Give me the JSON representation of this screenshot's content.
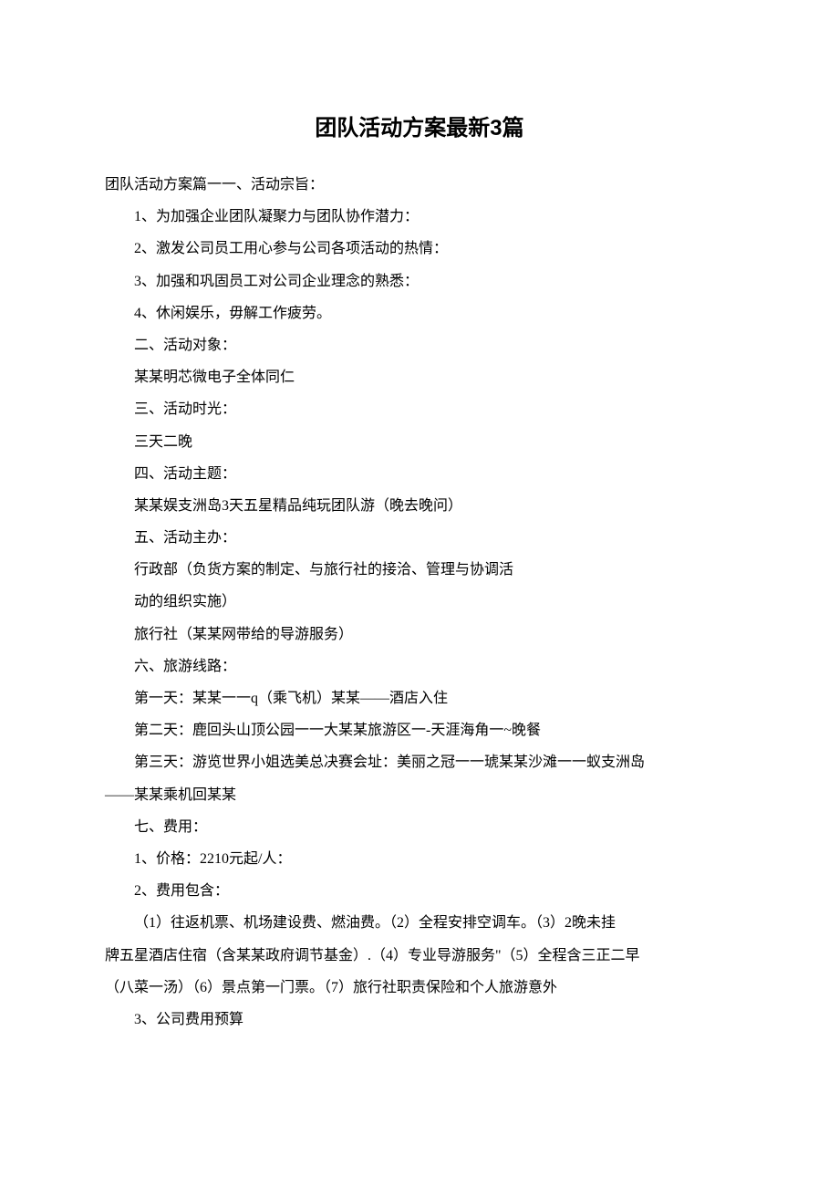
{
  "title": "团队活动方案最新3篇",
  "lines": [
    {
      "text": "团队活动方案篇一一、活动宗旨：",
      "indent": false
    },
    {
      "text": "1、为加强企业团队凝聚力与团队协作潜力：",
      "indent": true
    },
    {
      "text": "2、激发公司员工用心参与公司各项活动的热情：",
      "indent": true
    },
    {
      "text": "3、加强和巩固员工对公司企业理念的熟悉：",
      "indent": true
    },
    {
      "text": "4、休闲娱乐，毋解工作疲劳。",
      "indent": true
    },
    {
      "text": "二、活动对象：",
      "indent": true
    },
    {
      "text": "某某明芯微电子全体同仁",
      "indent": true
    },
    {
      "text": "三、活动时光：",
      "indent": true
    },
    {
      "text": "三天二晚",
      "indent": true
    },
    {
      "text": "四、活动主题：",
      "indent": true
    },
    {
      "text": "某某娱支洲岛3天五星精品纯玩团队游（晚去晚问）",
      "indent": true
    },
    {
      "text": "五、活动主办：",
      "indent": true
    },
    {
      "text": "行政部（负货方案的制定、与旅行社的接洽、管理与协调活",
      "indent": true
    },
    {
      "text": "动的组织实施）",
      "indent": true
    },
    {
      "text": "旅行社（某某网带给的导游服务）",
      "indent": true
    },
    {
      "text": "六、旅游线路：",
      "indent": true
    },
    {
      "text": "第一天：某某一一q（乘飞机）某某——酒店入住",
      "indent": true
    },
    {
      "text": "第二天：鹿回头山顶公园一一大某某旅游区一-天涯海角一~晚餐",
      "indent": true
    },
    {
      "text": "第三天：游览世界小姐选美总决赛会址：美丽之冠一一琥某某沙滩一一蚁支洲岛",
      "indent": true
    },
    {
      "text": "——某某乘机回某某",
      "indent": false
    },
    {
      "text": "七、费用：",
      "indent": true
    },
    {
      "text": "1、价格：2210元起/人：",
      "indent": true
    },
    {
      "text": "2、费用包含：",
      "indent": true
    },
    {
      "text": "（1）往返机票、机场建设费、燃油费。（2）全程安排空调车。（3）2晚未挂",
      "indent": true
    },
    {
      "text": "牌五星酒店住宿（含某某政府调节基金）.（4）专业导游服务\"（5）全程含三正二早",
      "indent": false
    },
    {
      "text": "（八菜一汤）（6）景点第一门票。（7）旅行社职责保险和个人旅游意外",
      "indent": false
    },
    {
      "text": "3、公司费用预算",
      "indent": true
    }
  ]
}
